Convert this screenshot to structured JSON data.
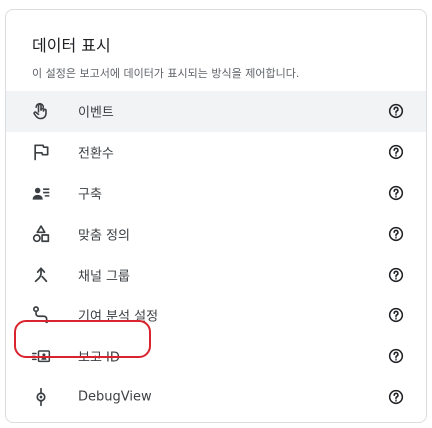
{
  "panel": {
    "title": "데이터 표시",
    "description": "이 설정은 보고서에 데이터가 표시되는 방식을 제어합니다."
  },
  "items": [
    {
      "label": "이벤트",
      "icon": "touch-icon"
    },
    {
      "label": "전환수",
      "icon": "flag-icon"
    },
    {
      "label": "구축",
      "icon": "audience-icon"
    },
    {
      "label": "맞춤 정의",
      "icon": "shapes-icon"
    },
    {
      "label": "채널 그룹",
      "icon": "merge-icon"
    },
    {
      "label": "기여 분석 설정",
      "icon": "attribution-path-icon"
    },
    {
      "label": "보고 ID",
      "icon": "reporting-id-icon"
    },
    {
      "label": "DebugView",
      "icon": "debug-icon"
    }
  ],
  "help_icon": "help-circle-icon",
  "highlight": {
    "target": "보고 ID",
    "color": "#d9232e"
  }
}
